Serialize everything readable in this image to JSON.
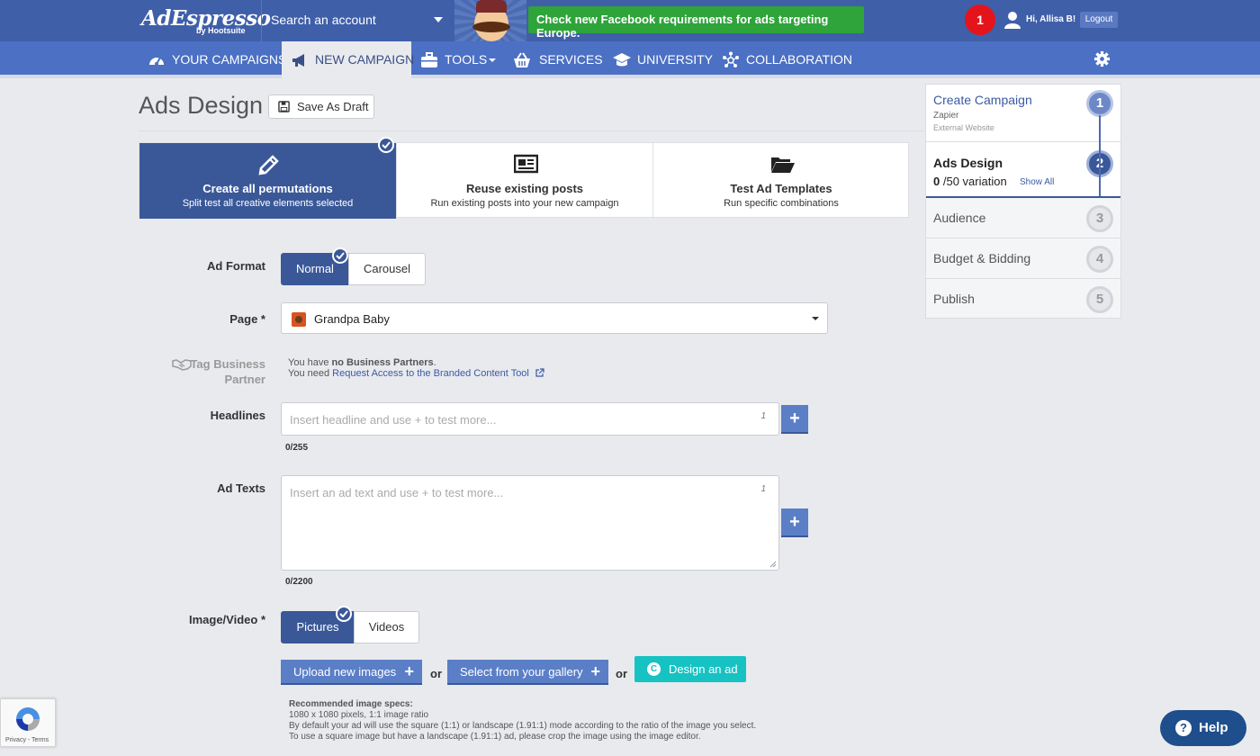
{
  "header": {
    "logo": "AdEspresso",
    "logo_sub": "by Hootsuite",
    "account_search": "Search an account",
    "promo": "Check new Facebook requirements for ads targeting Europe.",
    "notifications": "1",
    "greeting": "Hi, Allisa B!",
    "logout": "Logout"
  },
  "nav": {
    "items": [
      {
        "label": "YOUR CAMPAIGNS",
        "icon": "dashboard-icon"
      },
      {
        "label": "NEW CAMPAIGN",
        "icon": "megaphone-icon"
      },
      {
        "label": "TOOLS",
        "icon": "briefcase-icon"
      },
      {
        "label": "SERVICES",
        "icon": "basket-icon"
      },
      {
        "label": "UNIVERSITY",
        "icon": "graduation-cap-icon"
      },
      {
        "label": "COLLABORATION",
        "icon": "network-icon"
      }
    ]
  },
  "page": {
    "title": "Ads Design",
    "save_draft": "Save As Draft"
  },
  "modes": [
    {
      "title": "Create all permutations",
      "subtitle": "Split test all creative elements selected",
      "icon": "pencil-icon",
      "active": true
    },
    {
      "title": "Reuse existing posts",
      "subtitle": "Run existing posts into your new campaign",
      "icon": "newspaper-icon",
      "active": false
    },
    {
      "title": "Test Ad Templates",
      "subtitle": "Run specific combinations",
      "icon": "folder-open-icon",
      "active": false
    }
  ],
  "form": {
    "ad_format": {
      "label": "Ad Format",
      "options": [
        "Normal",
        "Carousel"
      ],
      "selected": "Normal"
    },
    "page": {
      "label": "Page *",
      "value": "Grandpa Baby"
    },
    "partner": {
      "label": "Tag Business Partner",
      "line1_pre": "You have ",
      "line1_bold": "no Business Partners",
      "line1_post": ".",
      "line2_pre": "You need ",
      "line2_link": "Request Access to the Branded Content Tool"
    },
    "headlines": {
      "label": "Headlines",
      "placeholder": "Insert headline and use + to test more...",
      "count": "1",
      "chars": "0/255"
    },
    "ad_texts": {
      "label": "Ad Texts",
      "placeholder": "Insert an ad text and use + to test more...",
      "count": "1",
      "chars": "0/2200"
    },
    "media": {
      "label": "Image/Video *",
      "options": [
        "Pictures",
        "Videos"
      ],
      "selected": "Pictures",
      "upload": "Upload new images",
      "gallery": "Select from your gallery",
      "or": "or",
      "design": "Design an ad"
    },
    "specs": {
      "title": "Recommended image specs:",
      "lines": [
        "1080 x 1080 pixels, 1:1 image ratio",
        "By default your ad will use the square (1:1) or landscape (1.91:1) mode according to the ratio of the image you select.",
        "To use a square image but have a landscape (1.91:1) ad, please crop the image using the image editor."
      ]
    }
  },
  "steps": [
    {
      "num": "1",
      "title": "Create Campaign",
      "sub1": "Zapier",
      "sub2": "External Website"
    },
    {
      "num": "2",
      "title": "Ads Design",
      "variation_count": "0",
      "variation_text": "/50 variation",
      "show_all": "Show All"
    },
    {
      "num": "3",
      "title": "Audience"
    },
    {
      "num": "4",
      "title": "Budget & Bidding"
    },
    {
      "num": "5",
      "title": "Publish"
    }
  ],
  "footer": {
    "recaptcha": "Privacy - Terms",
    "help": "Help"
  },
  "colors": {
    "brand": "#3f5fa9",
    "nav": "#4b70c4",
    "primary": "#3a5898",
    "promo": "#2ea43a",
    "design_btn": "#17c2c3",
    "alert": "#e5141b"
  }
}
